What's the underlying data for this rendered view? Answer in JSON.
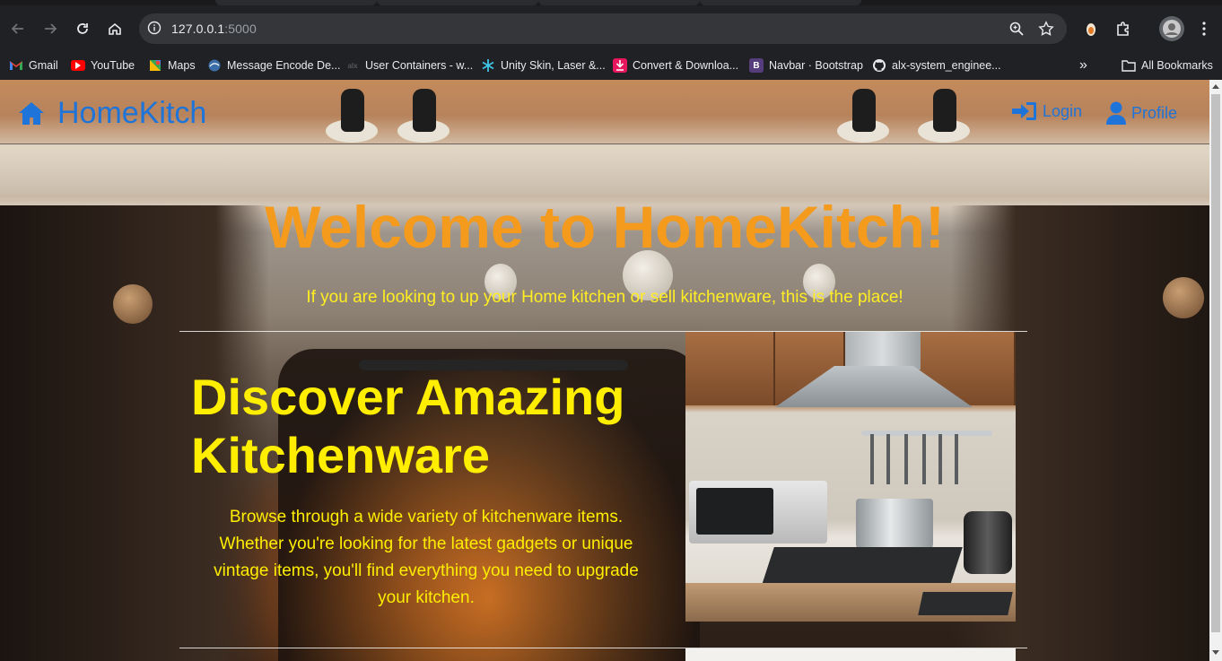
{
  "browser": {
    "url_host": "127.0.0.1",
    "url_port": ":5000",
    "bookmarks": [
      {
        "label": "Gmail",
        "icon": "gmail-icon"
      },
      {
        "label": "YouTube",
        "icon": "youtube-icon"
      },
      {
        "label": "Maps",
        "icon": "maps-icon"
      },
      {
        "label": "Message Encode De...",
        "icon": "globe-icon"
      },
      {
        "label": "User Containers - w...",
        "icon": "site-icon"
      },
      {
        "label": "Unity Skin, Laser &...",
        "icon": "snowflake-icon"
      },
      {
        "label": "Convert & Downloa...",
        "icon": "download-icon"
      },
      {
        "label": "Navbar · Bootstrap",
        "icon": "bootstrap-icon"
      },
      {
        "label": "alx-system_enginee...",
        "icon": "github-icon"
      }
    ],
    "more_label": "»",
    "all_bookmarks": "All Bookmarks",
    "bootstrap_letter": "B"
  },
  "site": {
    "brand": "HomeKitch",
    "nav": {
      "login": "Login",
      "profile": "Profile"
    },
    "hero": {
      "title": "Welcome to HomeKitch!",
      "subtitle": "If you are looking to up your Home kitchen or sell kitchenware, this is the place!"
    },
    "feature": {
      "title": "Discover Amazing Kitchenware",
      "body": "Browse through a wide variety of kitchenware items. Whether you're looking for the latest gadgets or unique vintage items, you'll find everything you need to upgrade your kitchen."
    }
  },
  "colors": {
    "brand_blue": "#1e74d9",
    "hero_orange": "#f49a1d",
    "feature_yellow": "#ffee00"
  }
}
